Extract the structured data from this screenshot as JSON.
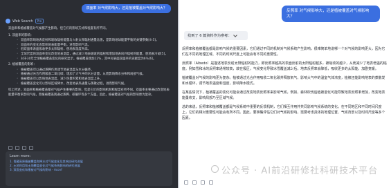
{
  "left": {
    "user_message": "双面率 对气候影响大，还是植被覆盖对气候影响大？",
    "source_label": "Web Search",
    "source_badge": "Pro",
    "intro": "双面率和植被覆盖对气候都产生影响，但它们的影响方式和程度有所不同。",
    "sections": [
      {
        "title": "1. 双面率的影响：",
        "items": [
          "双面率影响地表反射和吸收辐射能量与入射太阳辐射通量比值，是影响地球能量平衡的关键参数[4-5]。",
          "双面率的变化会影响地表能量平衡，进而影响气温。",
          "低双面率表面吸收更多太阳辐射，使地表温度升高。",
          "全球尺度的双面率变化改变地表温度，通过减少地表吸收的辐射和增加地表向外辐射的能量，使地表冷却[5]。",
          "对于30年全球植被覆盖变化的研究显示，植被覆盖增加12%，其中对表面双面率的贡献度为6%[6]。"
        ]
      },
      {
        "title": "2. 植被覆盖的影响：",
        "items": [
          "植被覆盖可以通过蒸腾作用调节地表温度与水分循环。",
          "植被通过光合作用吸收二氧化碳，增加了大气中的水分含量，从而影响降水分布和局部气候。",
          "植被覆盖可以影响地表温度，减少热量积累和地表温度上升。",
          "植被覆盖变化可以影响区域降水，改变地表热通量与蒸散过程，进而影响气候。"
        ]
      }
    ],
    "conclusion": "综上所述，双面率和植被覆盖都对气候产生重要的影响，但是它们的影响机制和程度有所不同。双面率主要通过改变地表能量平衡来影响气候，而植被覆盖则通过蒸腾、碳循环等多个方面。因此，植被覆盖对气候的影响更为复杂。",
    "learn_more": {
      "title": "Learn more:",
      "links": [
        "1. 青藏高原植被覆盖和降水对气候变化及其响应研究进展",
        "2. 土地利用和土地覆盖变化对气候系统影响的研究进展",
        "3. 双面变化和植被对气候的影响 - Aconf"
      ]
    }
  },
  "right": {
    "user_message": "反照率 对气候影响大，还是植被覆盖对气候影响大？",
    "search_status": "找到了 6 篇资料作为参考：",
    "paragraphs": [
      "反照率和植被覆盖都是影响气候的重要因素，它们通过不同的机制对气候系统产生影响，很难简单地说哪一个对气候的影响更大，因为它们在不同的地理区域、不同的时间尺度上可能会有不同的重要性。",
      "反照率（Albedo）是描述地表反射太阳辐射的能力，即反照率越高的表面反射的太阳辐射越多，被吸收的越少，从而减少了地表增温的幅度。例如雪和冰的反照率通常较高，故在极区，气候变化导致冰雪覆盖减少后，地表反照率会降低，吸收更多的太阳能，加剧变暖。",
      "植被覆盖对气候的影响更为复杂。植被通过光合作用吸收二氧化碳并释放氧气，影响大气中的温室气体浓度，植被还能影响地表的蒸散发和水循环，调节地表温度和湿度，影响降水模式。",
      "在某些情况下，植被覆盖的变化可能会通过改变地表反照率来影响气候，例如，森林砍伐后植被退化可能导致地表反照率增加，改变地表能量收支，影响局部乃至区域气候。",
      "总的来说，反照率和植被覆盖都是气候系统中重要的反馈机制，它们相互作用并共同影响气候系统的变化。在不同地区和不同时间尺度上，它们的相对重要性可能会有所不同。因此，要准确评估它们对气候的影响，需要考虑具体的地理位置、气候背景以及时间尺度等多个因素。"
    ]
  },
  "watermark": "公众号 · AI前沿研修社科研技术平台"
}
